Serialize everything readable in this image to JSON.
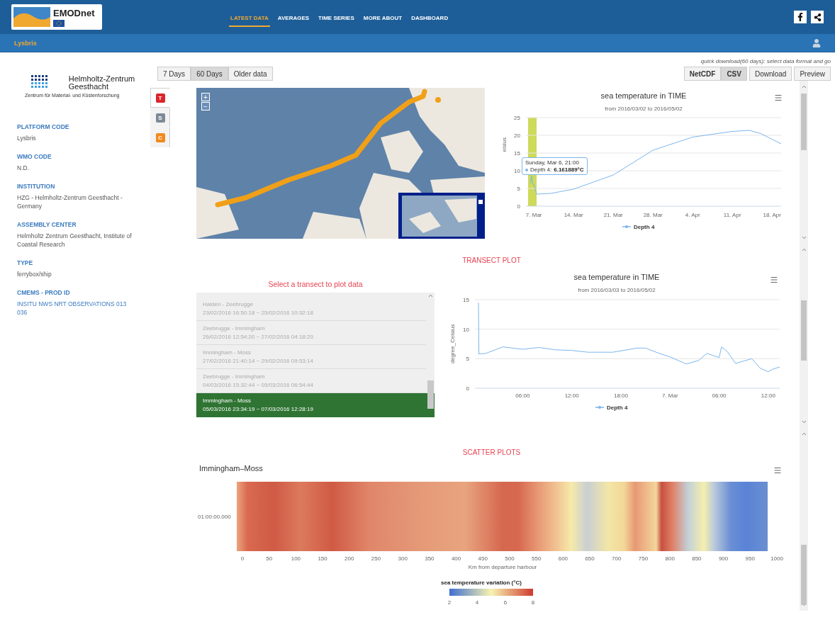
{
  "header": {
    "logo_text": "EMODnet",
    "nav": [
      {
        "label": "LATEST DATA",
        "selected": true
      },
      {
        "label": "AVERAGES",
        "selected": false
      },
      {
        "label": "TIME SERIES",
        "selected": false
      },
      {
        "label": "MORE ABOUT",
        "selected": false
      },
      {
        "label": "DASHBOARD",
        "selected": false
      }
    ]
  },
  "subbar": {
    "platform": "Lysbris"
  },
  "sidebar": {
    "logo": {
      "name_line_1": "Helmholtz-Zentrum",
      "name_line_2": "Geesthacht",
      "tagline": "Zentrum für Material- und Küstenforschung"
    },
    "fields": [
      {
        "label": "PLATFORM CODE",
        "value": "Lysbris",
        "link": false
      },
      {
        "label": "WMO CODE",
        "value": "N.D.",
        "link": false
      },
      {
        "label": "INSTITUTION",
        "value": "HZG - Helmholtz-Zentrum Geesthacht - Germany",
        "link": false
      },
      {
        "label": "ASSEMBLY CENTER",
        "value": "Helmholtz Zentrum Geesthacht, Institute of Coastal Research",
        "link": false
      },
      {
        "label": "TYPE",
        "value": "ferrybox/ship",
        "link": false
      },
      {
        "label": "CMEMS - PROD ID",
        "value": "INSITU NWS NRT OBSERVATIONS 013 036",
        "link": true
      }
    ]
  },
  "range_buttons": [
    {
      "label": "7 Days",
      "selected": false
    },
    {
      "label": "60 Days",
      "selected": true
    },
    {
      "label": "Older data",
      "selected": false
    }
  ],
  "quick_download": {
    "hint": "quick download(60 days): select data format and go",
    "formats": [
      {
        "label": "NetCDF",
        "selected": false
      },
      {
        "label": "CSV",
        "selected": true
      }
    ],
    "actions": [
      "Download",
      "Preview"
    ]
  },
  "parameter_tabs": [
    {
      "letter": "T",
      "color": "#d9262b",
      "selected": true
    },
    {
      "letter": "S",
      "color": "#7d8a96",
      "selected": false
    },
    {
      "letter": "C",
      "color": "#f08a1c",
      "selected": false
    }
  ],
  "map": {
    "zoom_in": "+",
    "zoom_out": "−"
  },
  "time_chart": {
    "subtitle": "from 2016/03/02 to 2016/05/02",
    "chart_data": {
      "type": "line",
      "title": "sea temperature in TIME",
      "ylabel": "elsius",
      "x": [
        "2016-03-06T09:36Z",
        "2016-03-06T14:24Z",
        "2016-03-06T19:12Z",
        "2016-03-07T00:00Z",
        "2016-03-07T04:48Z",
        "2016-03-07T12:00Z",
        "2016-03-10T00:00Z",
        "2016-03-14T00:00Z",
        "2016-03-21T00:00Z",
        "2016-03-28T00:00Z",
        "2016-04-04T00:00Z",
        "2016-04-11T00:00Z",
        "2016-04-14T00:00Z",
        "2016-04-16T00:00Z",
        "2016-04-19T14:24Z"
      ],
      "series": [
        {
          "name": "Depth 4",
          "color": "#7cb5ec",
          "values": [
            6.5,
            8.5,
            6.2,
            6.1,
            5.0,
            3.4,
            3.6,
            4.8,
            8.8,
            15.8,
            19.5,
            21.1,
            21.4,
            20.5,
            17.6
          ]
        }
      ],
      "xlim": [
        "2016-03-05T14:24Z",
        "2016-04-19T14:24Z"
      ],
      "ylim": [
        0,
        25
      ],
      "xticks": [
        {
          "value": "2016-03-07T00:00Z",
          "label": "7. Mar"
        },
        {
          "value": "2016-03-14T00:00Z",
          "label": "14. Mar"
        },
        {
          "value": "2016-03-21T00:00Z",
          "label": "21. Mar"
        },
        {
          "value": "2016-03-28T00:00Z",
          "label": "28. Mar"
        },
        {
          "value": "2016-04-04T00:00Z",
          "label": "4. Apr"
        },
        {
          "value": "2016-04-11T00:00Z",
          "label": "11. Apr"
        },
        {
          "value": "2016-04-18T00:00Z",
          "label": "18. Apr"
        }
      ],
      "yticks": [
        0,
        5,
        10,
        15,
        20,
        25
      ],
      "grid": true
    },
    "tooltip": {
      "time": "Sunday, Mar 6, 21:00",
      "series": "Depth 4:",
      "value": "6.161889°C"
    }
  },
  "transect_title": "TRANSECT PLOT",
  "transects": {
    "heading": "Select a transect to plot data",
    "items": [
      {
        "route": "Halden - Zeebrugge",
        "period": "23/02/2016 16:50:18 ~ 25/02/2016 10:32:18",
        "selected": false
      },
      {
        "route": "Zeebrugge - Immingham",
        "period": "26/02/2016 12:54:20 ~ 27/02/2016 04:18:20",
        "selected": false
      },
      {
        "route": "Immingham - Moss",
        "period": "27/02/2016 21:40:14 ~ 29/02/2016 09:53:14",
        "selected": false
      },
      {
        "route": "Zeebrugge - Immingham",
        "period": "04/03/2016 15:32:44 ~ 05/03/2016 06:54:44",
        "selected": false
      },
      {
        "route": "Immingham - Moss",
        "period": "05/03/2016 23:34:19 ~ 07/03/2016 12:28:19",
        "selected": true
      }
    ]
  },
  "transect_chart": {
    "subtitle": "from 2016/03/03 to 2016/05/02",
    "chart_data": {
      "type": "line",
      "title": "sea temperature in TIME",
      "ylabel": "degree_Celsius",
      "x": [
        "2016-03-06T00:36Z",
        "2016-03-06T00:39Z",
        "2016-03-06T01:30Z",
        "2016-03-06T03:00Z",
        "2016-03-06T03:36Z",
        "2016-03-06T06:00Z",
        "2016-03-06T08:00Z",
        "2016-03-06T10:00Z",
        "2016-03-06T12:00Z",
        "2016-03-06T14:00Z",
        "2016-03-06T17:00Z",
        "2016-03-06T20:00Z",
        "2016-03-06T21:00Z",
        "2016-03-06T22:30Z",
        "2016-03-07T00:00Z",
        "2016-03-07T02:00Z",
        "2016-03-07T03:30Z",
        "2016-03-07T04:30Z",
        "2016-03-07T06:00Z",
        "2016-03-07T06:18Z",
        "2016-03-07T07:00Z",
        "2016-03-07T08:00Z",
        "2016-03-07T10:00Z",
        "2016-03-07T11:00Z",
        "2016-03-07T12:00Z",
        "2016-03-07T12:30Z",
        "2016-03-07T13:24Z"
      ],
      "series": [
        {
          "name": "Depth 4",
          "color": "#7cb5ec",
          "values": [
            14.5,
            5.8,
            5.9,
            6.7,
            7.0,
            6.6,
            6.9,
            6.5,
            6.4,
            6.1,
            6.1,
            6.8,
            6.8,
            6.0,
            5.3,
            4.1,
            4.7,
            5.9,
            5.2,
            7.0,
            6.2,
            4.2,
            5.0,
            3.4,
            2.8,
            3.2,
            3.6
          ]
        }
      ],
      "xlim": [
        "2016-03-06T00:10Z",
        "2016-03-07T13:24Z"
      ],
      "ylim": [
        0,
        15
      ],
      "xticks": [
        {
          "value": "2016-03-06T06:00Z",
          "label": "06:00"
        },
        {
          "value": "2016-03-06T12:00Z",
          "label": "12:00"
        },
        {
          "value": "2016-03-06T18:00Z",
          "label": "18:00"
        },
        {
          "value": "2016-03-07T00:00Z",
          "label": "7. Mar"
        },
        {
          "value": "2016-03-07T06:00Z",
          "label": "06:00"
        },
        {
          "value": "2016-03-07T12:00Z",
          "label": "12:00"
        }
      ],
      "yticks": [
        0,
        5,
        10,
        15
      ],
      "grid": true
    }
  },
  "scatter_title": "SCATTER PLOTS",
  "heatmap": {
    "title": "Immingham–Moss",
    "ylabel": "01:00:00.000",
    "xticks": [
      "0",
      "50",
      "100",
      "150",
      "200",
      "250",
      "300",
      "350",
      "400",
      "450",
      "500",
      "550",
      "600",
      "650",
      "700",
      "750",
      "800",
      "850",
      "900",
      "950",
      "1000"
    ],
    "xlabel": "Km from departure harbour",
    "legend": {
      "title": "sea temperature variation (°C)",
      "ticks": [
        "2",
        "4",
        "6",
        "8"
      ]
    }
  }
}
